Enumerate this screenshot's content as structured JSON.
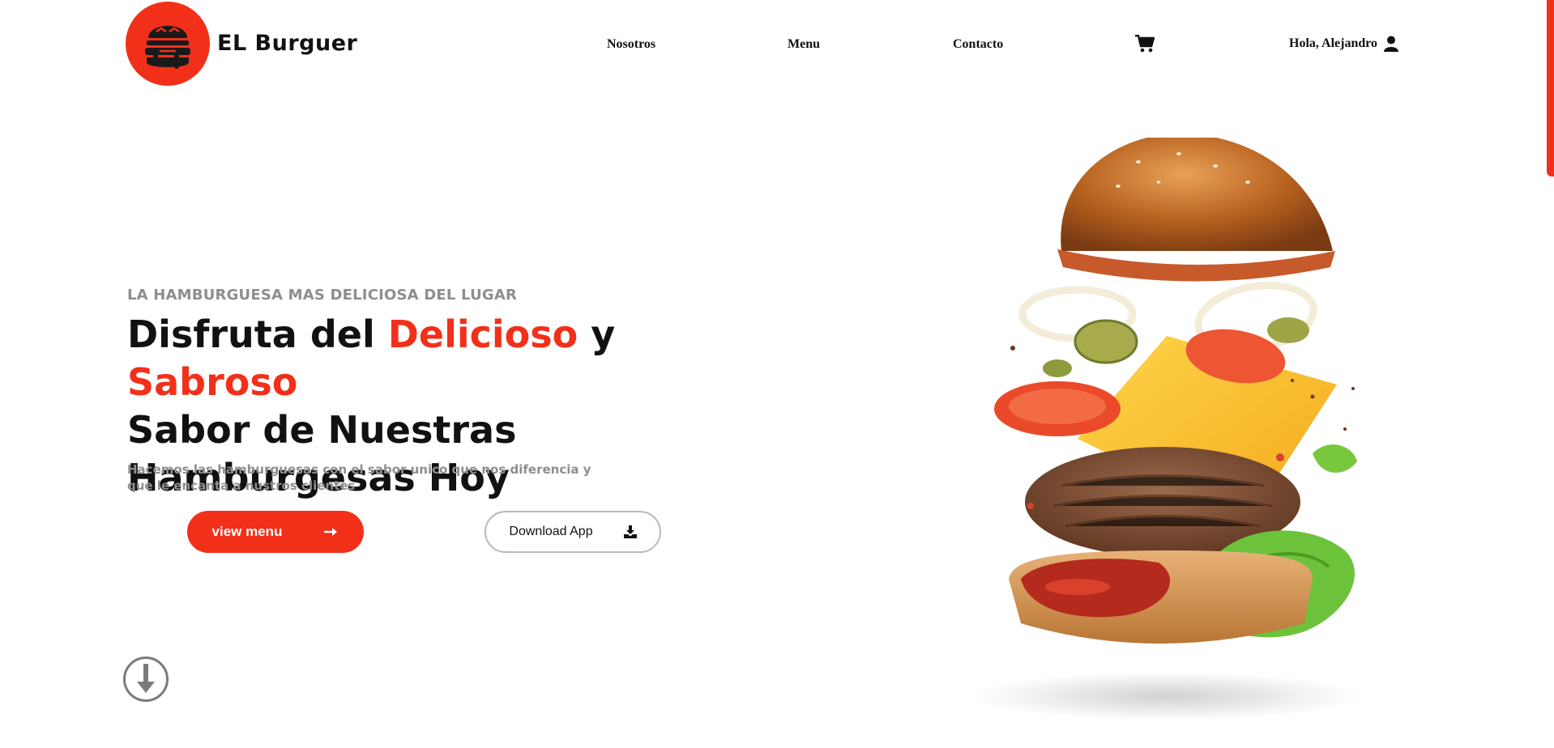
{
  "header": {
    "brand": "EL Burguer",
    "nav": [
      "Nosotros",
      "Menu",
      "Contacto"
    ],
    "user_greeting": "Hola, Alejandro"
  },
  "hero": {
    "eyebrow": "LA HAMBURGUESA MAS DELICIOSA DEL LUGAR",
    "headline": {
      "part1": "Disfruta del ",
      "accent1": "Delicioso",
      "part2": " y ",
      "accent2": "Sabroso",
      "part3": "Sabor de Nuestras Hamburgesas Hoy"
    },
    "description": "Hacemos las hamburguesas con el sabor unico que nos diferencia y que le encanta a nustros clientes",
    "primary_button": "view menu",
    "secondary_button": "Download App"
  },
  "icons": {
    "logo": "burger-logo-icon",
    "cart": "cart-icon",
    "user": "user-icon",
    "arrow": "arrow-right-icon",
    "download": "download-icon",
    "scroll": "arrow-down-circle-icon"
  },
  "colors": {
    "accent": "#f2301a",
    "muted": "#8e8e8e",
    "text": "#111111"
  }
}
